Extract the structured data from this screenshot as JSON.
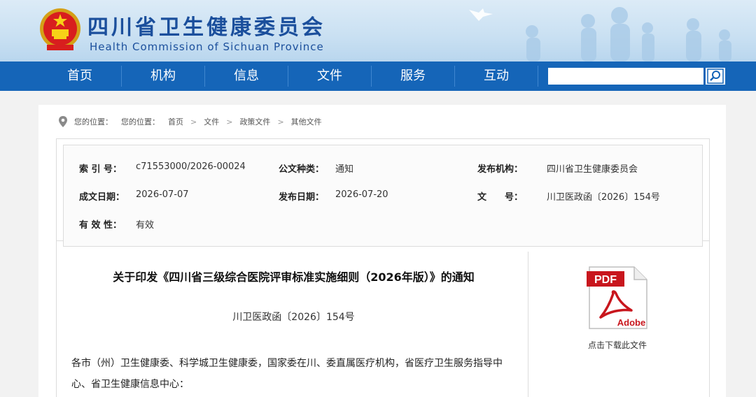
{
  "header": {
    "title": "四川省卫生健康委员会",
    "subtitle": "Health Commission of Sichuan Province"
  },
  "nav": {
    "items": [
      "首页",
      "机构",
      "信息",
      "文件",
      "服务",
      "互动"
    ],
    "search_placeholder": ""
  },
  "breadcrumb": {
    "prefix1": "您的位置：",
    "prefix2": "您的位置：",
    "items": [
      "首页",
      "文件",
      "政策文件",
      "其他文件"
    ]
  },
  "meta": {
    "index_label": "索 引 号：",
    "index_value": "c71553000/2026-00024",
    "type_label": "公文种类：",
    "type_value": "通知",
    "org_label": "发布机构：",
    "org_value": "四川省卫生健康委员会",
    "created_label": "成文日期：",
    "created_value": "2026-07-07",
    "published_label": "发布日期：",
    "published_value": "2026-07-20",
    "docno_label": "文　　号：",
    "docno_value": "川卫医政函〔2026〕154号",
    "validity_label": "有 效 性：",
    "validity_value": "有效"
  },
  "document": {
    "title": "关于印发《四川省三级综合医院评审标准实施细则（2026年版）》的通知",
    "number": "川卫医政函〔2026〕154号",
    "paragraph": "各市（州）卫生健康委、科学城卫生健康委，国家委在川、委直属医疗机构，省医疗卫生服务指导中心、省卫生健康信息中心："
  },
  "download": {
    "pdf_label": "PDF",
    "adobe_label": "Adobe",
    "text": "点击下载此文件"
  }
}
